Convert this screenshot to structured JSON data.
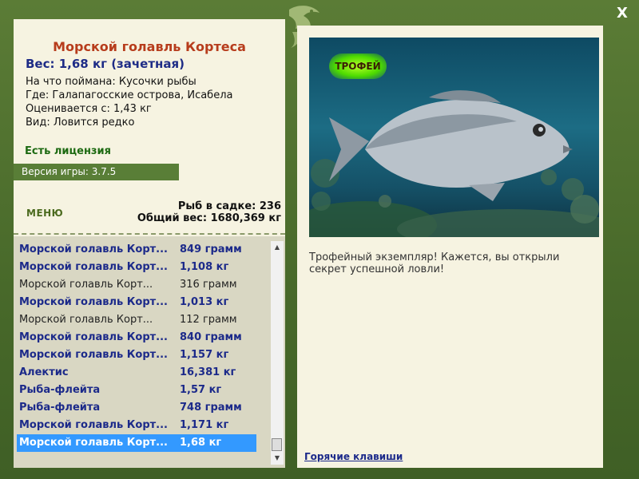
{
  "fish": {
    "title": "Морской голавль Кортеса",
    "weight": "Вес: 1,68 кг (зачетная)",
    "caught_on": "На что поймана: Кусочки рыбы",
    "location": "Где: Галапагосские острова, Исабела",
    "valued_from": "Оценивается с: 1,43 кг",
    "kind": "Вид: Ловится редко"
  },
  "license": "Есть лицензия",
  "version": "Версия игры: 3.7.5",
  "menu_label": "МЕНЮ",
  "stats": {
    "count": "Рыб в садке: 236",
    "total_weight": "Общий вес: 1680,369 кг"
  },
  "catch_list": [
    {
      "name": "Морской голавль Корт...",
      "weight": "849 грамм",
      "style": "bold"
    },
    {
      "name": "Морской голавль Корт...",
      "weight": "1,108 кг",
      "style": "bold"
    },
    {
      "name": "Морской голавль Корт...",
      "weight": "316 грамм",
      "style": "norm"
    },
    {
      "name": "Морской голавль Корт...",
      "weight": "1,013 кг",
      "style": "bold"
    },
    {
      "name": "Морской голавль Корт...",
      "weight": "112 грамм",
      "style": "norm"
    },
    {
      "name": "Морской голавль Корт...",
      "weight": "840 грамм",
      "style": "bold"
    },
    {
      "name": "Морской голавль Корт...",
      "weight": "1,157 кг",
      "style": "bold"
    },
    {
      "name": "Алектис",
      "weight": "16,381 кг",
      "style": "bold"
    },
    {
      "name": "Рыба-флейта",
      "weight": "1,57 кг",
      "style": "bold"
    },
    {
      "name": "Рыба-флейта",
      "weight": "748 грамм",
      "style": "bold"
    },
    {
      "name": "Морской голавль Корт...",
      "weight": "1,171 кг",
      "style": "bold"
    },
    {
      "name": "Морской голавль Корт...",
      "weight": "1,68 кг",
      "style": "sel"
    }
  ],
  "trophy_badge": "ТРОФЕЙ",
  "description": "Трофейный экземпляр! Кажется, вы открыли секрет успешной ловли!",
  "hotkeys_label": "Горячие клавиши",
  "close_label": "X",
  "icons": {
    "close": "close-icon",
    "logo": "fish-logo-icon",
    "scroll_up": "scroll-up-icon",
    "scroll_down": "scroll-down-icon"
  },
  "colors": {
    "frame": "#4d6d2e",
    "panel": "#f6f3e1",
    "title": "#b73c1c",
    "accent_blue": "#1c2a8a",
    "license_green": "#1d6a12",
    "selection": "#3399ff"
  }
}
